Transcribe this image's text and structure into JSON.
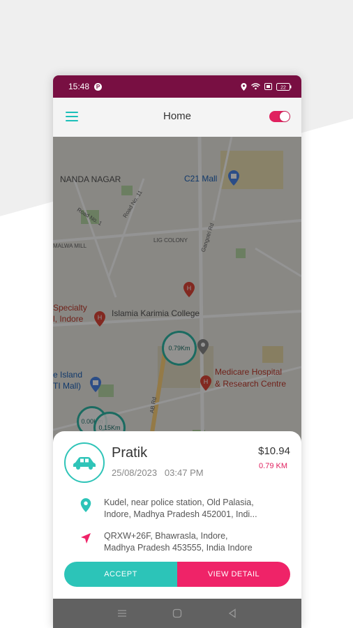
{
  "status_bar": {
    "time": "15:48",
    "badge": "P",
    "battery": "22"
  },
  "app_bar": {
    "title": "Home"
  },
  "map": {
    "labels": {
      "nanda_nagar": "NANDA NAGAR",
      "c21_mall": "C21 Mall",
      "road_no_1": "Road No. 1",
      "road_no_11": "Road No. 11",
      "lig_colony": "LIG COLONY",
      "malwa_mill": "MALWA MILL",
      "gangotri_rd": "Gangotri Rd",
      "specialty": "Specialty",
      "indore": "l, Indore",
      "islamia": "Islamia Karimia College",
      "medicare_1": "Medicare Hospital",
      "medicare_2": "& Research Centre",
      "island": "e Island",
      "ti_mall": "TI Mall)",
      "ab_rd": "AB Rd"
    },
    "clusters": {
      "c1": "0.79Km",
      "c2": "0.00Km",
      "c3": "0.15Km"
    }
  },
  "ride": {
    "name": "Pratik",
    "date": "25/08/2023",
    "time": "03:47 PM",
    "price": "$10.94",
    "distance": "0.79 KM",
    "pickup_line1": "Kudel, near police station, Old Palasia,",
    "pickup_line2": "Indore, Madhya Pradesh 452001, Indi...",
    "drop_line1": "QRXW+26F, Bhawrasla, Indore,",
    "drop_line2": "Madhya Pradesh 453555, India Indore"
  },
  "actions": {
    "accept": "ACCEPT",
    "view_detail": "VIEW DETAIL"
  },
  "colors": {
    "status_bar": "#780f42",
    "accent_teal": "#2cc4b8",
    "accent_pink": "#ef2368"
  },
  "icons": [
    "menu-icon",
    "toggle-switch",
    "car-icon",
    "location-pin-icon",
    "navigation-arrow-icon",
    "hospital-icon",
    "shopping-icon"
  ]
}
